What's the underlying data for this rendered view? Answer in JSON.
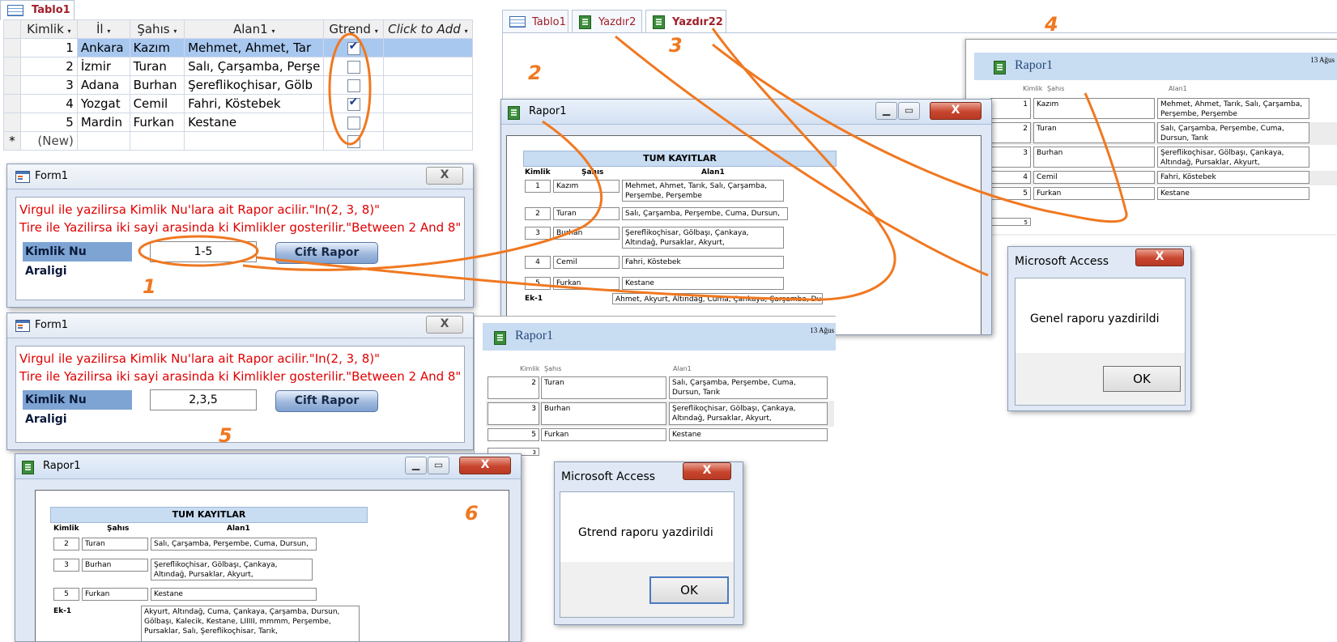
{
  "table_tab": {
    "label": "Tablo1"
  },
  "table": {
    "headers": [
      "Kimlik",
      "İl",
      "Şahıs",
      "Alan1",
      "Gtrend",
      "Click to Add"
    ],
    "rows": [
      {
        "kimlik": "1",
        "il": "Ankara",
        "sahis": "Kazım",
        "alan1": "Mehmet, Ahmet, Tar",
        "gtrend": true
      },
      {
        "kimlik": "2",
        "il": "İzmir",
        "sahis": "Turan",
        "alan1": "Salı, Çarşamba, Perşe",
        "gtrend": false
      },
      {
        "kimlik": "3",
        "il": "Adana",
        "sahis": "Burhan",
        "alan1": "Şereflikoçhisar, Gölb",
        "gtrend": false
      },
      {
        "kimlik": "4",
        "il": "Yozgat",
        "sahis": "Cemil",
        "alan1": "Fahri, Köstebek",
        "gtrend": true
      },
      {
        "kimlik": "5",
        "il": "Mardin",
        "sahis": "Furkan",
        "alan1": "Kestane",
        "gtrend": false
      }
    ],
    "new_row_marker": "*",
    "new_row_label": "(New)"
  },
  "form1a": {
    "title": "Form1",
    "line1": "Virgul ile yazilirsa Kimlik Nu'lara ait Rapor acilir.\"In(2, 3, 8)\"",
    "line2": "Tire ile Yazilirsa iki sayi arasinda ki Kimlikler gosterilir.\"Between 2 And 8\"",
    "field_label": "Kimlik Nu Araligi",
    "field_value": "1-5",
    "button": "Cift Rapor",
    "close": "X"
  },
  "form1b": {
    "title": "Form1",
    "line1": "Virgul ile yazilirsa Kimlik Nu'lara ait Rapor acilir.\"In(2, 3, 8)\"",
    "line2": "Tire ile Yazilirsa iki sayi arasinda ki Kimlikler gosterilir.\"Between 2 And 8\"",
    "field_label": "Kimlik Nu Araligi",
    "field_value": "2,3,5",
    "button": "Cift Rapor",
    "close": "X"
  },
  "tabs": [
    "Tablo1",
    "Yazdır2",
    "Yazdır22"
  ],
  "labels": {
    "n1": "1",
    "n2": "2",
    "n3": "3",
    "n4": "4",
    "n5": "5",
    "n6": "6"
  },
  "report_window_a": {
    "title": "Rapor1",
    "header": "TUM KAYITLAR",
    "col_kimlik": "Kimlik",
    "col_sahis": "Şahıs",
    "col_alan": "Alan1",
    "rows": [
      {
        "k": "1",
        "s": "Kazım",
        "a": "Mehmet, Ahmet, Tarık, Salı, Çarşamba, Perşembe, Perşembe"
      },
      {
        "k": "2",
        "s": "Turan",
        "a": "Salı, Çarşamba, Perşembe, Cuma, Dursun, Tarık"
      },
      {
        "k": "3",
        "s": "Burhan",
        "a": "Şereflikoçhisar, Gölbaşı, Çankaya, Altındağ, Pursaklar, Akyurt, Kalecik,mmmm, LIIIII,LIIIII"
      },
      {
        "k": "4",
        "s": "Cemil",
        "a": "Fahri, Köstebek"
      },
      {
        "k": "5",
        "s": "Furkan",
        "a": "Kestane"
      }
    ],
    "ek_label": "Ek-1",
    "ek_text": "Ahmet, Akyurt, Altındağ, Cuma, Çankaya, Çarşamba, Dursun"
  },
  "report_print_top": {
    "title": "Rapor1",
    "date": "13 Ağus",
    "col_kimlik": "Kimlik",
    "col_sahis": "Şahıs",
    "col_alan": "Alan1",
    "rows": [
      {
        "k": "1",
        "s": "Kazım",
        "a": "Mehmet, Ahmet, Tarık, Salı, Çarşamba, Perşembe, Perşembe"
      },
      {
        "k": "2",
        "s": "Turan",
        "a": "Salı, Çarşamba, Perşembe, Cuma, Dursun, Tarık"
      },
      {
        "k": "3",
        "s": "Burhan",
        "a": "Şereflikoçhisar, Gölbaşı, Çankaya, Altındağ, Pursaklar, Akyurt, Kalecik,mmmm, LIIIII,LIIIII"
      },
      {
        "k": "4",
        "s": "Cemil",
        "a": "Fahri, Köstebek"
      },
      {
        "k": "5",
        "s": "Furkan",
        "a": "Kestane"
      }
    ],
    "footer_count": "5"
  },
  "report_print_mid": {
    "title": "Rapor1",
    "date": "13 Ağus",
    "col_kimlik": "Kimlik",
    "col_sahis": "Şahıs",
    "col_alan": "Alan1",
    "rows": [
      {
        "k": "2",
        "s": "Turan",
        "a": "Salı, Çarşamba, Perşembe, Cuma, Dursun, Tarık"
      },
      {
        "k": "3",
        "s": "Burhan",
        "a": "Şereflikoçhisar, Gölbaşı, Çankaya, Altındağ, Pursaklar, Akyurt, Kalecik,mmmm, LIIIII,LIIIII"
      },
      {
        "k": "5",
        "s": "Furkan",
        "a": "Kestane"
      }
    ],
    "footer_count": "3"
  },
  "report_window_b": {
    "title": "Rapor1",
    "header": "TUM KAYITLAR",
    "col_kimlik": "Kimlik",
    "col_sahis": "Şahıs",
    "col_alan": "Alan1",
    "rows": [
      {
        "k": "2",
        "s": "Turan",
        "a": "Salı, Çarşamba, Perşembe, Cuma, Dursun, Tarık"
      },
      {
        "k": "3",
        "s": "Burhan",
        "a": "Şereflikoçhisar, Gölbaşı, Çankaya, Altındağ, Pursaklar, Akyurt, Kalecik,mmmm, LIIIII,LIIIII"
      },
      {
        "k": "5",
        "s": "Furkan",
        "a": "Kestane"
      }
    ],
    "ek_label": "Ek-1",
    "ek_text": "Akyurt, Altındağ, Cuma, Çankaya, Çarşamba, Dursun, Gölbaşı, Kalecik, Kestane, LIIIII, mmmm, Perşembe, Pursaklar, Salı, Şereflikoçhisar, Tarık,"
  },
  "msg_genel": {
    "title": "Microsoft Access",
    "message": "Genel raporu yazdirildi",
    "ok": "OK",
    "close": "X"
  },
  "msg_gtrend": {
    "title": "Microsoft Access",
    "message": "Gtrend raporu yazdirildi",
    "ok": "OK",
    "close": "X"
  },
  "colors": {
    "accent_orange": "#f07820",
    "red_text": "#e00000",
    "selection": "#a8c8f0"
  }
}
